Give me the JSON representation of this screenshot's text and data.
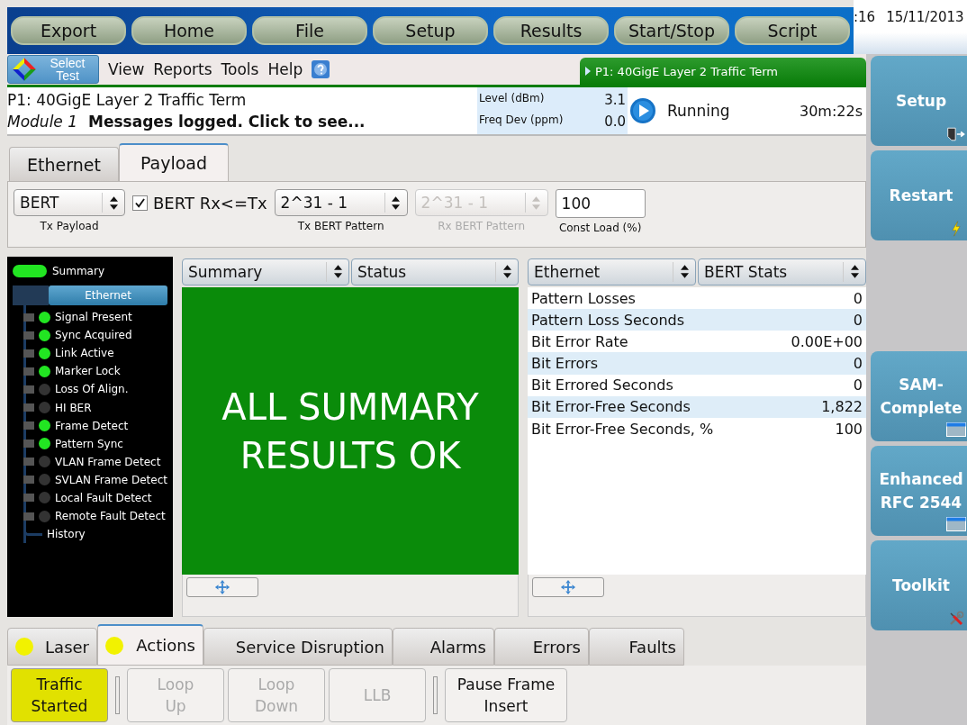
{
  "top_buttons": [
    "Export",
    "Home",
    "File",
    "Setup",
    "Results",
    "Start/Stop",
    "Script"
  ],
  "clock": {
    "time": ":16",
    "date": "15/11/2013"
  },
  "menu": {
    "select_test": [
      "Select",
      "Test"
    ],
    "items": [
      "View",
      "Reports",
      "Tools",
      "Help"
    ]
  },
  "test_tab": "P1: 40GigE Layer 2 Traffic Term",
  "info": {
    "title": "P1: 40GigE Layer 2 Traffic Term",
    "module": "Module 1",
    "message": "Messages logged. Click to see...",
    "level_label": "Level (dBm)",
    "level_value": "3.1",
    "freq_label": "Freq Dev (ppm)",
    "freq_value": "0.0",
    "status": "Running",
    "elapsed": "30m:22s"
  },
  "config_tabs": [
    {
      "label": "Ethernet",
      "selected": false
    },
    {
      "label": "Payload",
      "selected": true
    }
  ],
  "config": {
    "tx_payload": {
      "value": "BERT",
      "label": "Tx Payload"
    },
    "bert_check": {
      "label": "BERT Rx<=Tx",
      "checked": true
    },
    "tx_pattern": {
      "value": "2^31 - 1",
      "label": "Tx BERT Pattern",
      "disabled": false
    },
    "rx_pattern": {
      "value": "2^31 - 1",
      "label": "Rx BERT Pattern",
      "disabled": true
    },
    "const_load": {
      "value": "100",
      "label": "Const Load (%)"
    }
  },
  "tree": {
    "summary": {
      "label": "Summary",
      "on": true
    },
    "group": "Ethernet",
    "children": [
      {
        "label": "Signal Present",
        "on": true
      },
      {
        "label": "Sync Acquired",
        "on": true
      },
      {
        "label": "Link Active",
        "on": true
      },
      {
        "label": "Marker Lock",
        "on": true
      },
      {
        "label": "Loss Of Align.",
        "on": false
      },
      {
        "label": "HI BER",
        "on": false
      },
      {
        "label": "Frame Detect",
        "on": true
      },
      {
        "label": "Pattern Sync",
        "on": true
      },
      {
        "label": "VLAN Frame Detect",
        "on": false
      },
      {
        "label": "SVLAN Frame Detect",
        "on": false
      },
      {
        "label": "Local Fault Detect",
        "on": false
      },
      {
        "label": "Remote Fault Detect",
        "on": false
      }
    ],
    "history": "History"
  },
  "summary_panel": {
    "selectors": [
      "Summary",
      "Status"
    ],
    "message": "ALL SUMMARY RESULTS OK"
  },
  "results_panel": {
    "selectors": [
      "Ethernet",
      "BERT Stats"
    ],
    "rows": [
      {
        "name": "Pattern Losses",
        "value": "0"
      },
      {
        "name": "Pattern Loss Seconds",
        "value": "0"
      },
      {
        "name": "Bit Error Rate",
        "value": "0.00E+00"
      },
      {
        "name": "Bit Errors",
        "value": "0"
      },
      {
        "name": "Bit Errored Seconds",
        "value": "0"
      },
      {
        "name": "Bit Error-Free Seconds",
        "value": "1,822"
      },
      {
        "name": "Bit Error-Free Seconds, %",
        "value": "100"
      }
    ]
  },
  "bottom_tabs": [
    {
      "label": "Laser",
      "selected": false,
      "indicator": true
    },
    {
      "label": "Actions",
      "selected": true,
      "indicator": true
    },
    {
      "label": "Service Disruption",
      "selected": false,
      "indicator": false
    },
    {
      "label": "Alarms",
      "selected": false,
      "indicator": false
    },
    {
      "label": "Errors",
      "selected": false,
      "indicator": false
    },
    {
      "label": "Faults",
      "selected": false,
      "indicator": false
    }
  ],
  "actions": [
    {
      "kind": "button",
      "label": [
        "Traffic",
        "Started"
      ],
      "active": true,
      "disabled": false
    },
    {
      "kind": "separator"
    },
    {
      "kind": "button",
      "label": [
        "Loop",
        "Up"
      ],
      "active": false,
      "disabled": true
    },
    {
      "kind": "button",
      "label": [
        "Loop",
        "Down"
      ],
      "active": false,
      "disabled": true
    },
    {
      "kind": "button",
      "label": [
        "LLB"
      ],
      "active": false,
      "disabled": true
    },
    {
      "kind": "separator"
    },
    {
      "kind": "button",
      "label": [
        "Pause Frame",
        "Insert"
      ],
      "active": false,
      "disabled": false
    }
  ],
  "side_buttons_top": [
    {
      "label": [
        "Setup"
      ],
      "kind": "exit"
    },
    {
      "label": [
        "Restart"
      ],
      "kind": "bolt"
    }
  ],
  "side_buttons_bottom": [
    {
      "label": [
        "SAM-",
        "Complete"
      ],
      "kind": "window"
    },
    {
      "label": [
        "Enhanced",
        "RFC 2544"
      ],
      "kind": "window"
    },
    {
      "label": [
        "Toolkit"
      ],
      "kind": "tools"
    }
  ]
}
